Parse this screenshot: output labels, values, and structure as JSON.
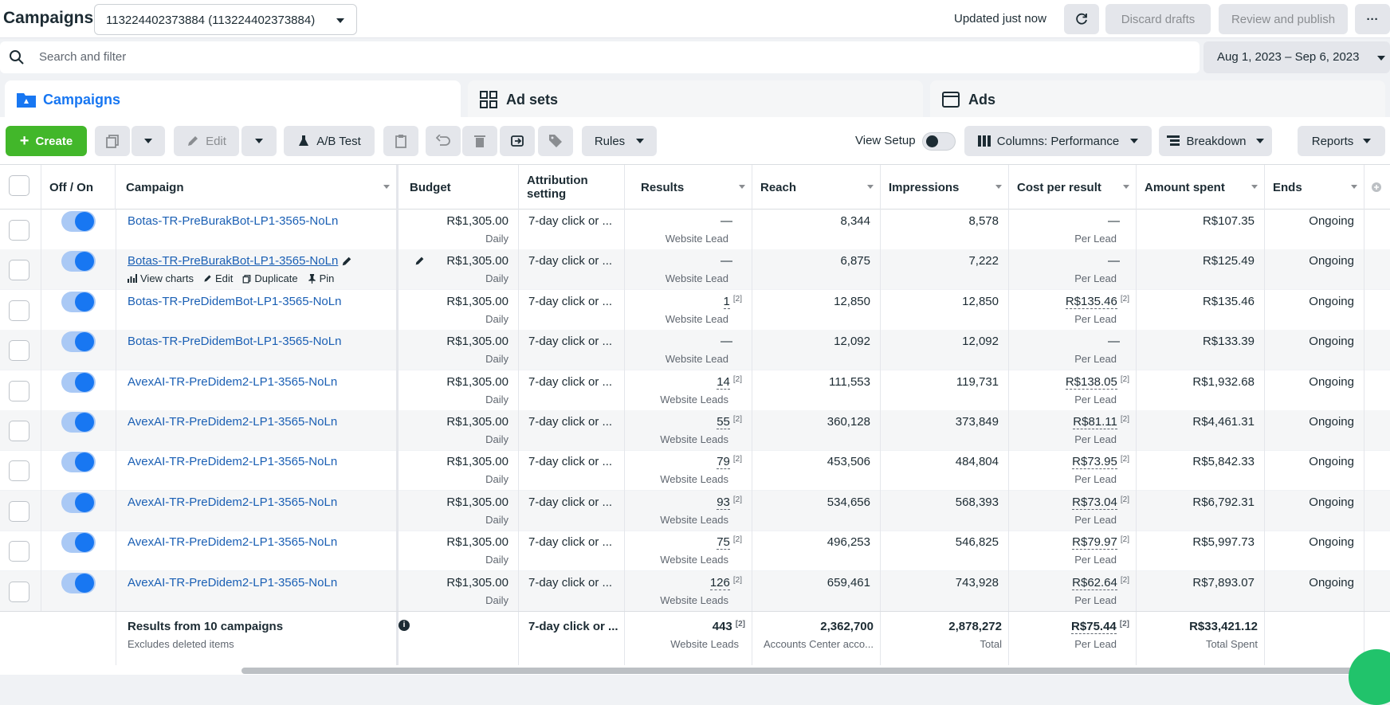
{
  "topbar": {
    "title": "Campaigns",
    "account": "113224402373884 (113224402373884)",
    "updated": "Updated just now",
    "discard": "Discard drafts",
    "review": "Review and publish",
    "more": "···"
  },
  "search": {
    "placeholder": "Search and filter",
    "date_range": "Aug 1, 2023 – Sep 6, 2023"
  },
  "tabs": [
    {
      "label": "Campaigns",
      "icon": "folder-icon",
      "active": true
    },
    {
      "label": "Ad sets",
      "icon": "grid-icon",
      "active": false
    },
    {
      "label": "Ads",
      "icon": "ad-window-icon",
      "active": false
    }
  ],
  "toolbar": {
    "create": "Create",
    "edit": "Edit",
    "ab_test": "A/B Test",
    "rules": "Rules",
    "view_setup": "View Setup",
    "columns": "Columns: Performance",
    "breakdown": "Breakdown",
    "reports": "Reports"
  },
  "columns": {
    "off_on": "Off / On",
    "campaign": "Campaign",
    "budget": "Budget",
    "attribution": "Attribution setting",
    "results": "Results",
    "reach": "Reach",
    "impressions": "Impressions",
    "cost_per_result": "Cost per result",
    "amount_spent": "Amount spent",
    "ends": "Ends"
  },
  "row_actions": {
    "view_charts": "View charts",
    "edit": "Edit",
    "duplicate": "Duplicate",
    "pin": "Pin"
  },
  "rows": [
    {
      "name": "Botas-TR-PreBurakBot-LP1-3565-NoLn",
      "budget": "R$1,305.00",
      "budget_sub": "Daily",
      "attribution": "7-day click or ...",
      "results": "—",
      "results_sup": "",
      "results_sub": "Website Lead",
      "reach": "8,344",
      "impressions": "8,578",
      "cpr": "—",
      "cpr_sup": "",
      "cpr_sub": "Per Lead",
      "spent": "R$107.35",
      "ends": "Ongoing"
    },
    {
      "name": "Botas-TR-PreBurakBot-LP1-3565-NoLn",
      "budget": "R$1,305.00",
      "budget_sub": "Daily",
      "attribution": "7-day click or ...",
      "results": "—",
      "results_sup": "",
      "results_sub": "Website Lead",
      "reach": "6,875",
      "impressions": "7,222",
      "cpr": "—",
      "cpr_sup": "",
      "cpr_sub": "Per Lead",
      "spent": "R$125.49",
      "ends": "Ongoing"
    },
    {
      "name": "Botas-TR-PreDidemBot-LP1-3565-NoLn",
      "budget": "R$1,305.00",
      "budget_sub": "Daily",
      "attribution": "7-day click or ...",
      "results": "1",
      "results_sup": "[2]",
      "results_sub": "Website Lead",
      "reach": "12,850",
      "impressions": "12,850",
      "cpr": "R$135.46",
      "cpr_sup": "[2]",
      "cpr_sub": "Per Lead",
      "spent": "R$135.46",
      "ends": "Ongoing"
    },
    {
      "name": "Botas-TR-PreDidemBot-LP1-3565-NoLn",
      "budget": "R$1,305.00",
      "budget_sub": "Daily",
      "attribution": "7-day click or ...",
      "results": "—",
      "results_sup": "",
      "results_sub": "Website Lead",
      "reach": "12,092",
      "impressions": "12,092",
      "cpr": "—",
      "cpr_sup": "",
      "cpr_sub": "Per Lead",
      "spent": "R$133.39",
      "ends": "Ongoing"
    },
    {
      "name": "AvexAI-TR-PreDidem2-LP1-3565-NoLn",
      "budget": "R$1,305.00",
      "budget_sub": "Daily",
      "attribution": "7-day click or ...",
      "results": "14",
      "results_sup": "[2]",
      "results_sub": "Website Leads",
      "reach": "111,553",
      "impressions": "119,731",
      "cpr": "R$138.05",
      "cpr_sup": "[2]",
      "cpr_sub": "Per Lead",
      "spent": "R$1,932.68",
      "ends": "Ongoing"
    },
    {
      "name": "AvexAI-TR-PreDidem2-LP1-3565-NoLn",
      "budget": "R$1,305.00",
      "budget_sub": "Daily",
      "attribution": "7-day click or ...",
      "results": "55",
      "results_sup": "[2]",
      "results_sub": "Website Leads",
      "reach": "360,128",
      "impressions": "373,849",
      "cpr": "R$81.11",
      "cpr_sup": "[2]",
      "cpr_sub": "Per Lead",
      "spent": "R$4,461.31",
      "ends": "Ongoing"
    },
    {
      "name": "AvexAI-TR-PreDidem2-LP1-3565-NoLn",
      "budget": "R$1,305.00",
      "budget_sub": "Daily",
      "attribution": "7-day click or ...",
      "results": "79",
      "results_sup": "[2]",
      "results_sub": "Website Leads",
      "reach": "453,506",
      "impressions": "484,804",
      "cpr": "R$73.95",
      "cpr_sup": "[2]",
      "cpr_sub": "Per Lead",
      "spent": "R$5,842.33",
      "ends": "Ongoing"
    },
    {
      "name": "AvexAI-TR-PreDidem2-LP1-3565-NoLn",
      "budget": "R$1,305.00",
      "budget_sub": "Daily",
      "attribution": "7-day click or ...",
      "results": "93",
      "results_sup": "[2]",
      "results_sub": "Website Leads",
      "reach": "534,656",
      "impressions": "568,393",
      "cpr": "R$73.04",
      "cpr_sup": "[2]",
      "cpr_sub": "Per Lead",
      "spent": "R$6,792.31",
      "ends": "Ongoing"
    },
    {
      "name": "AvexAI-TR-PreDidem2-LP1-3565-NoLn",
      "budget": "R$1,305.00",
      "budget_sub": "Daily",
      "attribution": "7-day click or ...",
      "results": "75",
      "results_sup": "[2]",
      "results_sub": "Website Leads",
      "reach": "496,253",
      "impressions": "546,825",
      "cpr": "R$79.97",
      "cpr_sup": "[2]",
      "cpr_sub": "Per Lead",
      "spent": "R$5,997.73",
      "ends": "Ongoing"
    },
    {
      "name": "AvexAI-TR-PreDidem2-LP1-3565-NoLn",
      "budget": "R$1,305.00",
      "budget_sub": "Daily",
      "attribution": "7-day click or ...",
      "results": "126",
      "results_sup": "[2]",
      "results_sub": "Website Leads",
      "reach": "659,461",
      "impressions": "743,928",
      "cpr": "R$62.64",
      "cpr_sup": "[2]",
      "cpr_sub": "Per Lead",
      "spent": "R$7,893.07",
      "ends": "Ongoing"
    }
  ],
  "footer": {
    "title": "Results from 10 campaigns",
    "subtitle": "Excludes deleted items",
    "attribution": "7-day click or ...",
    "results": "443",
    "results_sup": "[2]",
    "results_sub": "Website Leads",
    "reach": "2,362,700",
    "reach_sub": "Accounts Center acco...",
    "impressions": "2,878,272",
    "impressions_sub": "Total",
    "cpr": "R$75.44",
    "cpr_sup": "[2]",
    "cpr_sub": "Per Lead",
    "spent": "R$33,421.12",
    "spent_sub": "Total Spent"
  }
}
